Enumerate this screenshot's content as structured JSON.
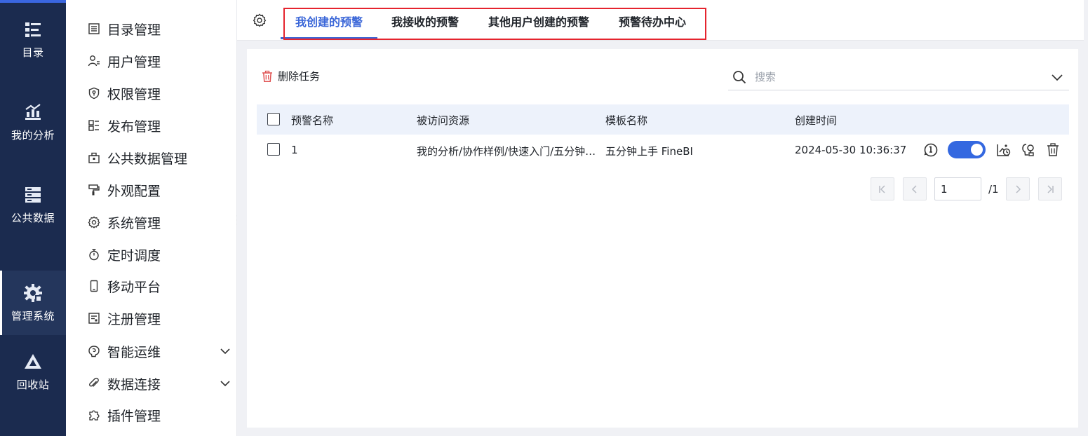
{
  "rail": {
    "items": [
      {
        "label": "目录",
        "icon": "catalog-icon"
      },
      {
        "label": "我的分析",
        "icon": "analysis-icon"
      },
      {
        "label": "公共数据",
        "icon": "database-icon"
      },
      {
        "label": "管理系统",
        "icon": "admin-gear-icon",
        "active": true
      },
      {
        "label": "回收站",
        "icon": "recycle-icon"
      }
    ]
  },
  "menu": {
    "items": [
      {
        "label": "目录管理",
        "icon": "list-icon"
      },
      {
        "label": "用户管理",
        "icon": "user-icon"
      },
      {
        "label": "权限管理",
        "icon": "shield-icon"
      },
      {
        "label": "发布管理",
        "icon": "layout-icon"
      },
      {
        "label": "公共数据管理",
        "icon": "briefcase-icon"
      },
      {
        "label": "外观配置",
        "icon": "paint-roller-icon"
      },
      {
        "label": "系统管理",
        "icon": "gear-icon"
      },
      {
        "label": "定时调度",
        "icon": "stopwatch-icon"
      },
      {
        "label": "移动平台",
        "icon": "mobile-icon"
      },
      {
        "label": "注册管理",
        "icon": "register-icon"
      },
      {
        "label": "智能运维",
        "icon": "brain-icon",
        "expandable": true
      },
      {
        "label": "数据连接",
        "icon": "paperclip-icon",
        "expandable": true
      },
      {
        "label": "插件管理",
        "icon": "puzzle-icon"
      }
    ]
  },
  "tabs": [
    {
      "label": "我创建的预警",
      "active": true
    },
    {
      "label": "我接收的预警"
    },
    {
      "label": "其他用户创建的预警"
    },
    {
      "label": "预警待办中心"
    }
  ],
  "toolbar": {
    "delete_label": "删除任务",
    "search_placeholder": "搜索"
  },
  "table": {
    "headers": [
      "预警名称",
      "被访问资源",
      "模板名称",
      "创建时间"
    ],
    "rows": [
      {
        "name": "1",
        "resource": "我的分析/协作样例/快速入门/五分钟上手 FineBI",
        "template": "五分钟上手 FineBI",
        "created": "2024-05-30 10:36:37",
        "enabled": true
      }
    ]
  },
  "pagination": {
    "current": "1",
    "total_label": "/1"
  },
  "colors": {
    "rail_bg": "#1b2b4f",
    "accent": "#3b67d8",
    "highlight_border": "#e5242e",
    "table_header_bg": "#edf2fb",
    "delete_red": "#e05555"
  }
}
